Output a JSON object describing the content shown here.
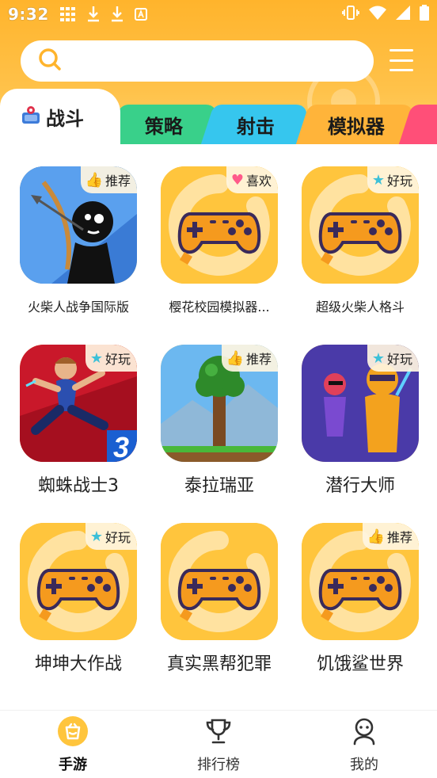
{
  "status_bar": {
    "time": "9:32"
  },
  "search": {
    "placeholder": ""
  },
  "tabs": [
    {
      "label": "战斗",
      "active": true
    },
    {
      "label": "策略"
    },
    {
      "label": "射击"
    },
    {
      "label": "模拟器"
    }
  ],
  "games": [
    {
      "name": "火柴人战争国际版",
      "badge": "推荐",
      "badge_icon": "thumb-up-icon",
      "image": "stickman-archer"
    },
    {
      "name": "樱花校园模拟器...",
      "badge": "喜欢",
      "badge_icon": "heart-icon",
      "image": "gamepad-placeholder"
    },
    {
      "name": "超级火柴人格斗",
      "badge": "好玩",
      "badge_icon": "star-icon",
      "image": "gamepad-placeholder"
    },
    {
      "name": "蜘蛛战士3",
      "badge": "好玩",
      "badge_icon": "star-icon",
      "image": "spider-fighter"
    },
    {
      "name": "泰拉瑞亚",
      "badge": "推荐",
      "badge_icon": "thumb-up-icon",
      "image": "terraria-tree"
    },
    {
      "name": "潜行大师",
      "badge": "好玩",
      "badge_icon": "star-icon",
      "image": "stealth-master"
    },
    {
      "name": "坤坤大作战",
      "badge": "好玩",
      "badge_icon": "star-icon",
      "image": "gamepad-placeholder"
    },
    {
      "name": "真实黑帮犯罪",
      "badge": "",
      "badge_icon": "",
      "image": "gamepad-placeholder"
    },
    {
      "name": "饥饿鲨世界",
      "badge": "推荐",
      "badge_icon": "thumb-up-icon",
      "image": "gamepad-placeholder"
    }
  ],
  "bottom_nav": [
    {
      "label": "手游",
      "icon": "game-bag-icon",
      "active": true
    },
    {
      "label": "排行榜",
      "icon": "trophy-icon"
    },
    {
      "label": "我的",
      "icon": "profile-icon"
    }
  ],
  "colors": {
    "accent": "#ffb42c",
    "tab_green": "#39d08a",
    "tab_blue": "#36c6ee",
    "tab_orange": "#ffb43a",
    "tab_pink": "#ff4f78"
  }
}
